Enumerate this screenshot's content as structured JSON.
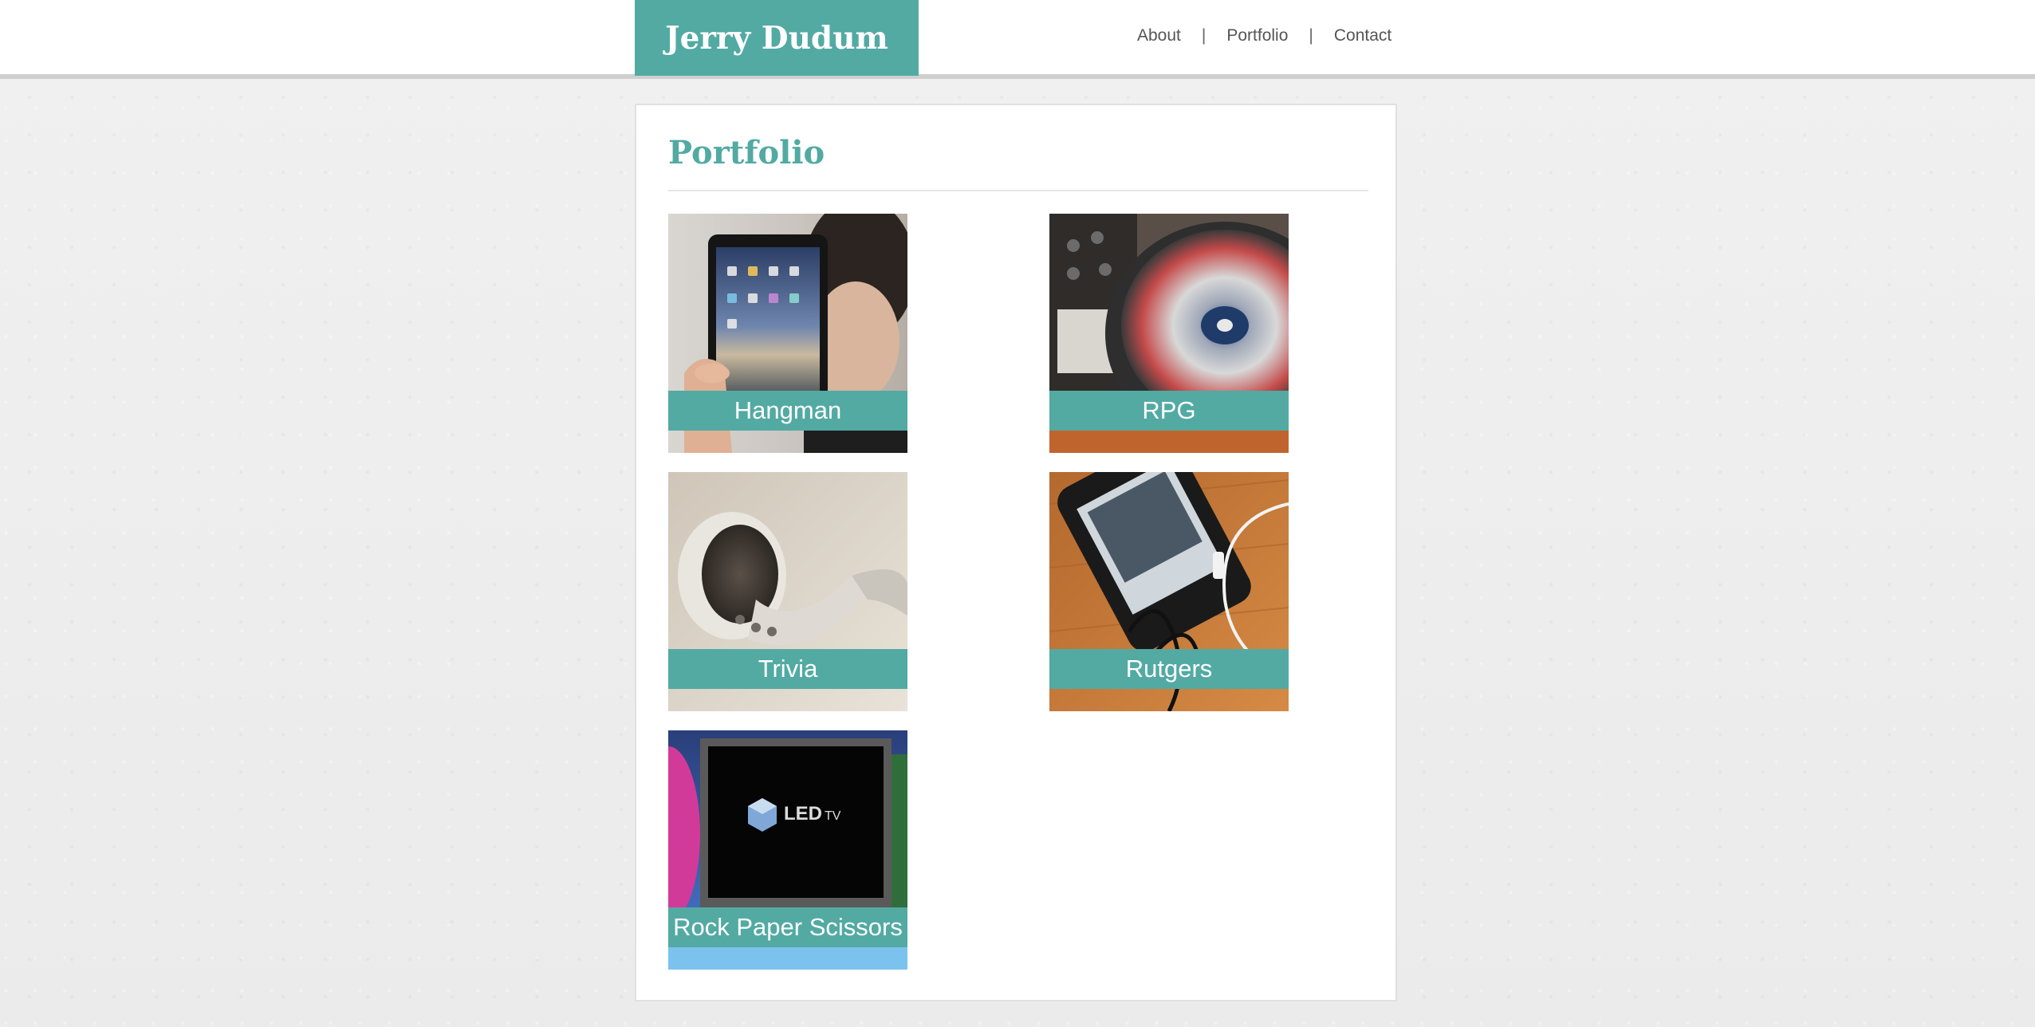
{
  "header": {
    "logo_text": "Jerry Dudum",
    "nav": [
      {
        "label": "About"
      },
      {
        "label": "Portfolio"
      },
      {
        "label": "Contact"
      }
    ],
    "separator": "|"
  },
  "main": {
    "title": "Portfolio",
    "projects": [
      {
        "label": "Hangman",
        "thumbnail": "tablet-photo"
      },
      {
        "label": "RPG",
        "thumbnail": "turntable-photo"
      },
      {
        "label": "Trivia",
        "thumbnail": "earbuds-photo"
      },
      {
        "label": "Rutgers",
        "thumbnail": "phone-headphones-photo"
      },
      {
        "label": "Rock Paper Scissors",
        "thumbnail": "led-tv-photo"
      }
    ]
  },
  "colors": {
    "accent": "#52aaa3",
    "background": "#eeeeee",
    "panel": "#ffffff"
  }
}
